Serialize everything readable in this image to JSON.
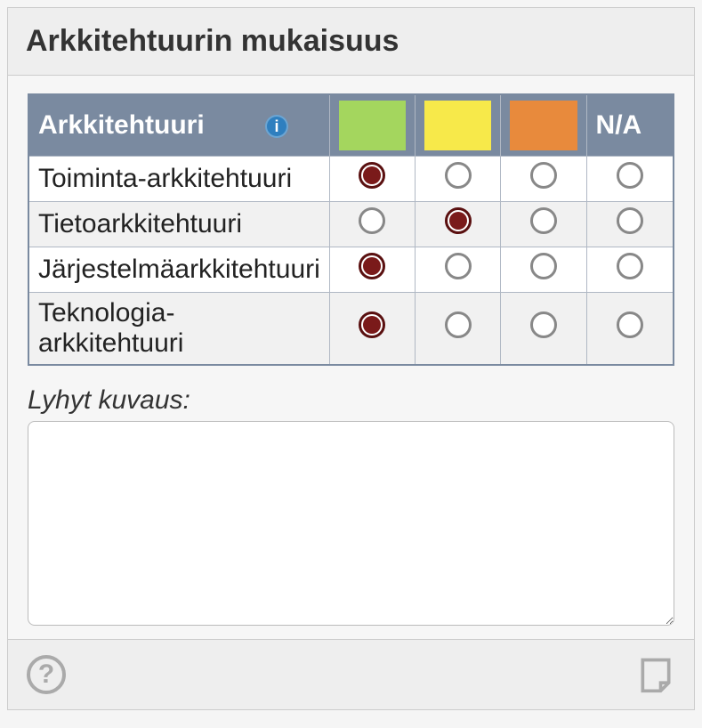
{
  "panel": {
    "title": "Arkkitehtuurin mukaisuus",
    "help_symbol": "?"
  },
  "table": {
    "header": {
      "label_col": "Arkkitehtuuri",
      "na_col": "N/A",
      "status_colors": {
        "green": "#a4d65e",
        "yellow": "#f7e94a",
        "orange": "#e88a3c"
      }
    },
    "rows": [
      {
        "label": "Toiminta-arkkitehtuuri",
        "selected": 0
      },
      {
        "label": "Tietoarkkitehtuuri",
        "selected": 1
      },
      {
        "label": "Järjestelmäarkkitehtuuri",
        "selected": 0
      },
      {
        "label": "Teknologia-arkkitehtuuri",
        "selected": 0
      }
    ]
  },
  "description": {
    "label": "Lyhyt kuvaus:",
    "value": ""
  }
}
